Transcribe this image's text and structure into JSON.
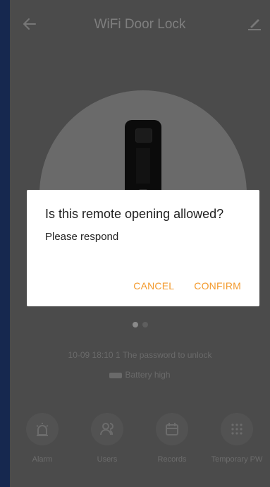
{
  "app": {
    "title": "WiFi Door Lock"
  },
  "status": {
    "last_event": "10-09 18:10 1 The password to unlock",
    "battery": "Battery high"
  },
  "nav": {
    "items": [
      {
        "label": "Alarm",
        "icon": "alarm-icon"
      },
      {
        "label": "Users",
        "icon": "users-icon"
      },
      {
        "label": "Records",
        "icon": "calendar-icon"
      },
      {
        "label": "Temporary PW",
        "icon": "keypad-icon"
      }
    ]
  },
  "dialog": {
    "title": "Is this remote opening allowed?",
    "message": "Please respond",
    "cancel_label": "CANCEL",
    "confirm_label": "CONFIRM"
  },
  "colors": {
    "overlay_background": "#4b4b4b",
    "accent": "#f39a2d",
    "dialog_background": "#ffffff"
  },
  "pager": {
    "pages": 2,
    "active_index": 0
  }
}
